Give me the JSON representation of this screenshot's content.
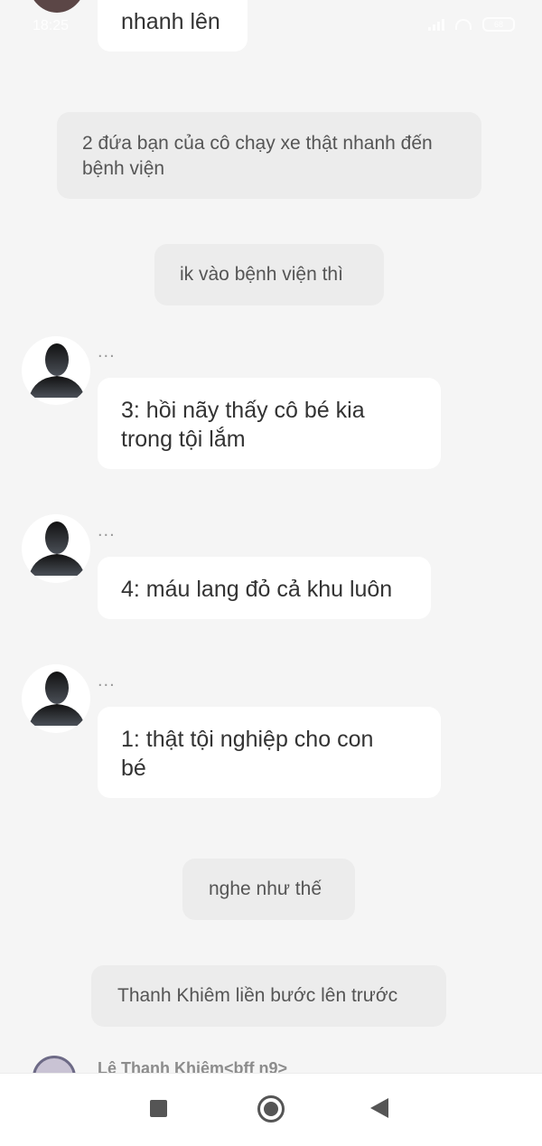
{
  "status_bar": {
    "time": "18:25",
    "battery": "68"
  },
  "messages": [
    {
      "kind": "received",
      "text": "nhanh lên"
    },
    {
      "kind": "narration",
      "text": "2 đứa bạn của cô chạy xe thật nhanh đến bệnh viện"
    },
    {
      "kind": "narration",
      "text": "ik vào bệnh viện thì"
    },
    {
      "kind": "received",
      "sender": "...",
      "text": "3: hồi nãy thấy cô bé kia trong tội lắm"
    },
    {
      "kind": "received",
      "sender": "...",
      "text": "4: máu lang đỏ cả khu luôn"
    },
    {
      "kind": "received",
      "sender": "...",
      "text": "1: thật tội nghiệp cho con bé"
    },
    {
      "kind": "narration",
      "text": "nghe như thế"
    },
    {
      "kind": "narration",
      "text": "Thanh Khiêm liền bước lên trước"
    }
  ],
  "next_sender": "Lê Thanh Khiêm<bff n9>",
  "navbar": {
    "recents_icon": "square-icon",
    "home_icon": "circle-icon",
    "back_icon": "triangle-back-icon"
  }
}
